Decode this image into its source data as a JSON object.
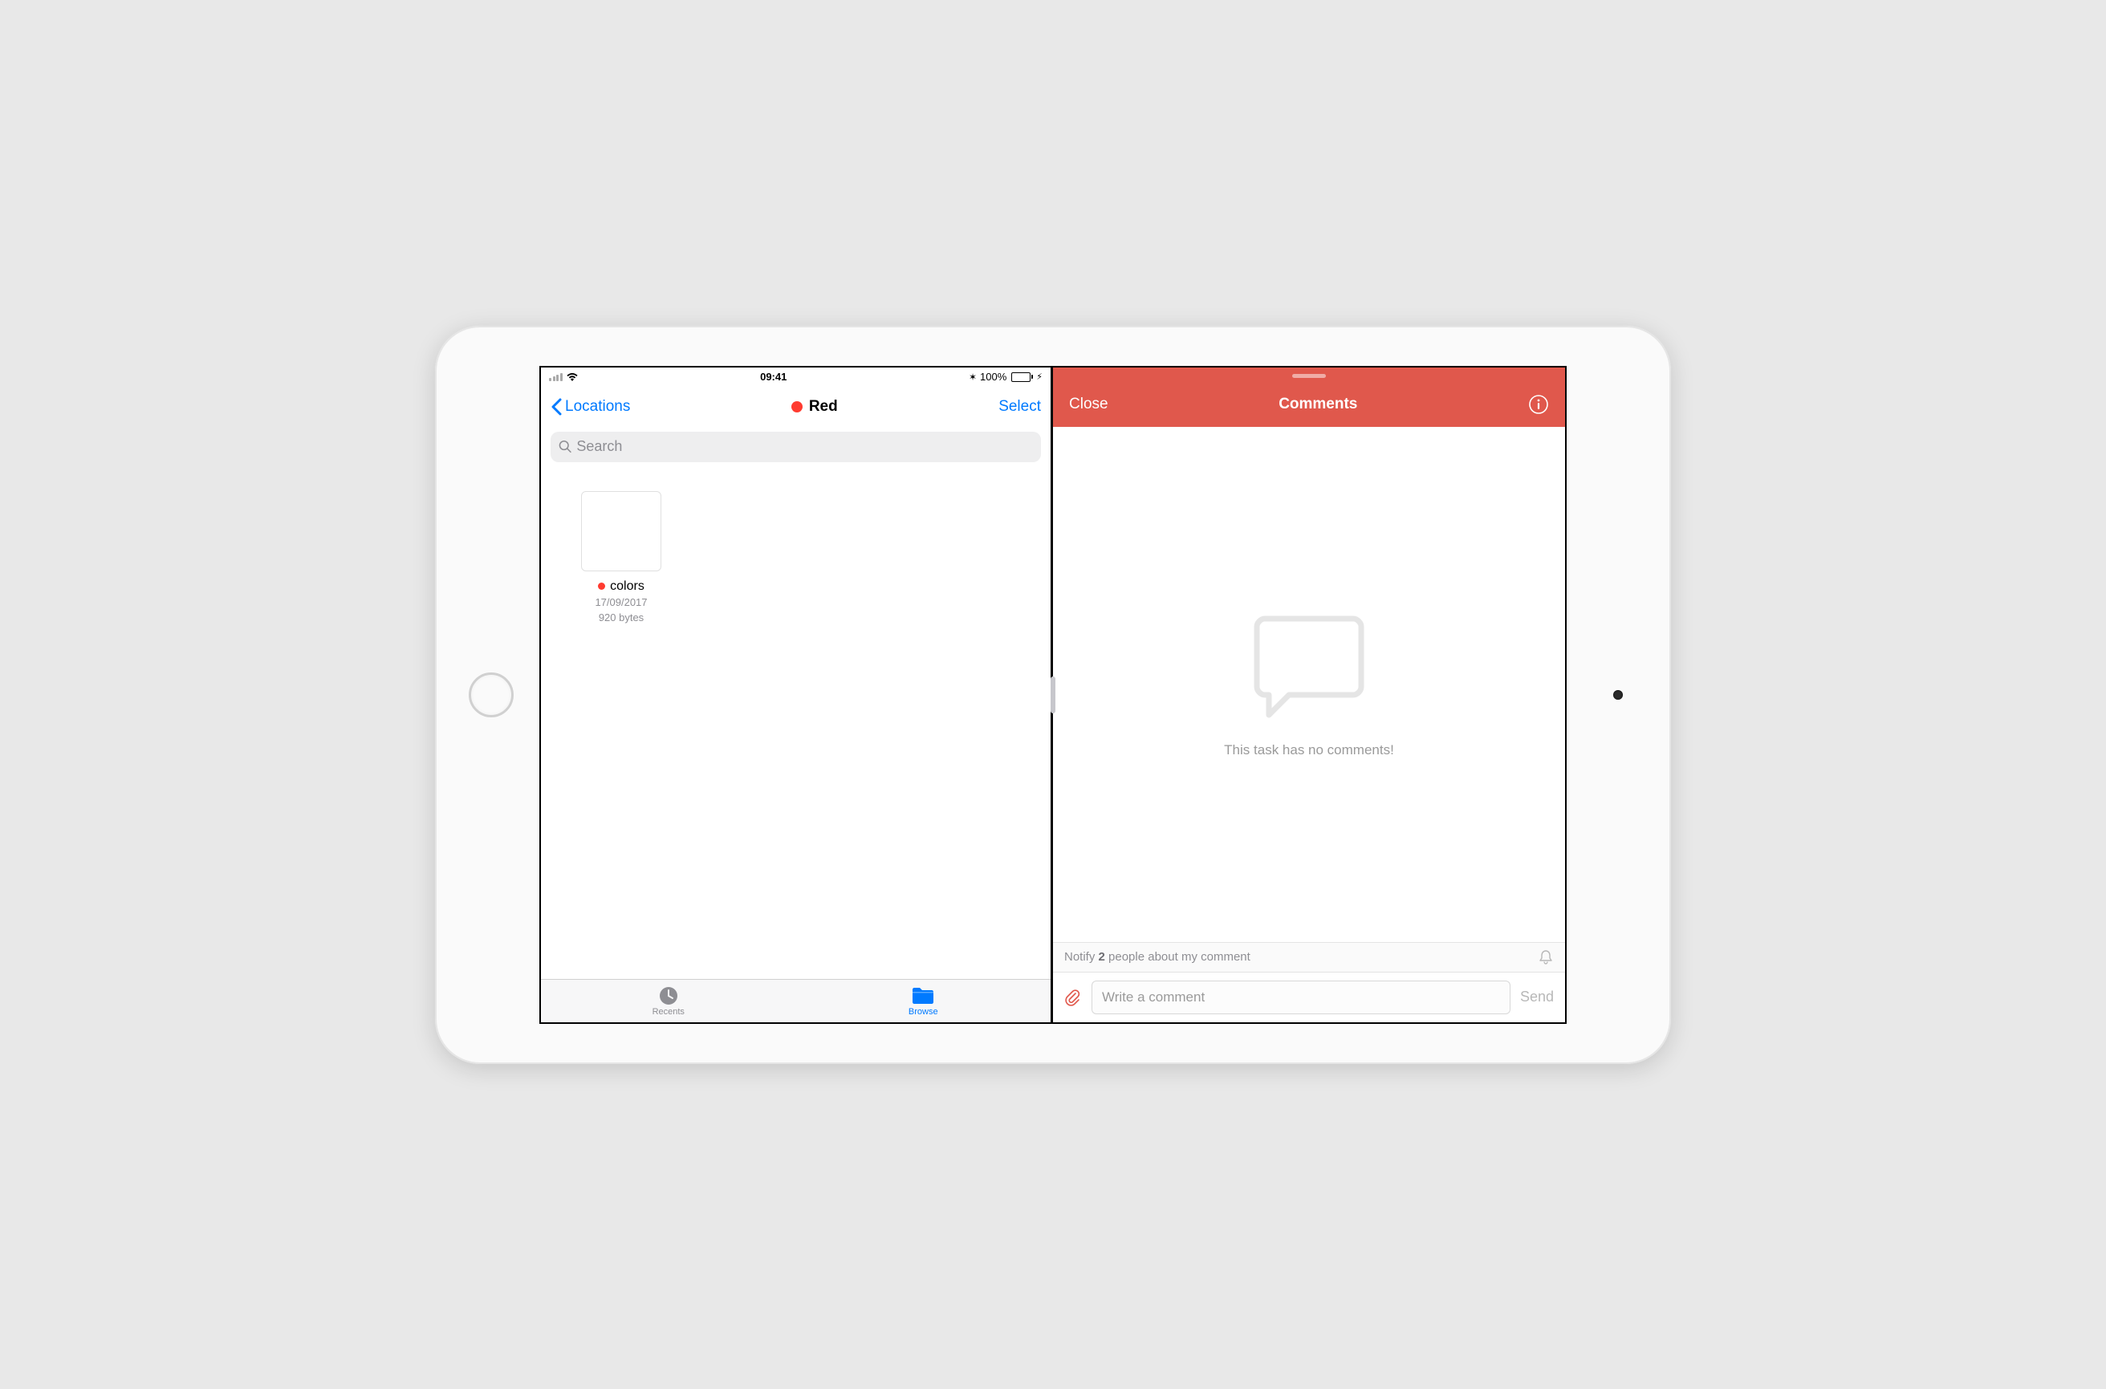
{
  "status": {
    "time": "09:41",
    "battery_pct": "100%"
  },
  "files": {
    "nav": {
      "back_label": "Locations",
      "title": "Red",
      "select_label": "Select"
    },
    "search": {
      "placeholder": "Search"
    },
    "items": [
      {
        "name": "colors",
        "date": "17/09/2017",
        "size": "920 bytes",
        "tag_color": "#ff3b30"
      }
    ],
    "tabs": {
      "recents": "Recents",
      "browse": "Browse"
    }
  },
  "todoist": {
    "close_label": "Close",
    "title": "Comments",
    "empty_message": "This task has no comments!",
    "notify_prefix": "Notify ",
    "notify_count": "2",
    "notify_suffix": " people about my comment",
    "compose_placeholder": "Write a comment",
    "send_label": "Send"
  },
  "colors": {
    "ios_blue": "#007aff",
    "todoist_red": "#e0584c"
  }
}
